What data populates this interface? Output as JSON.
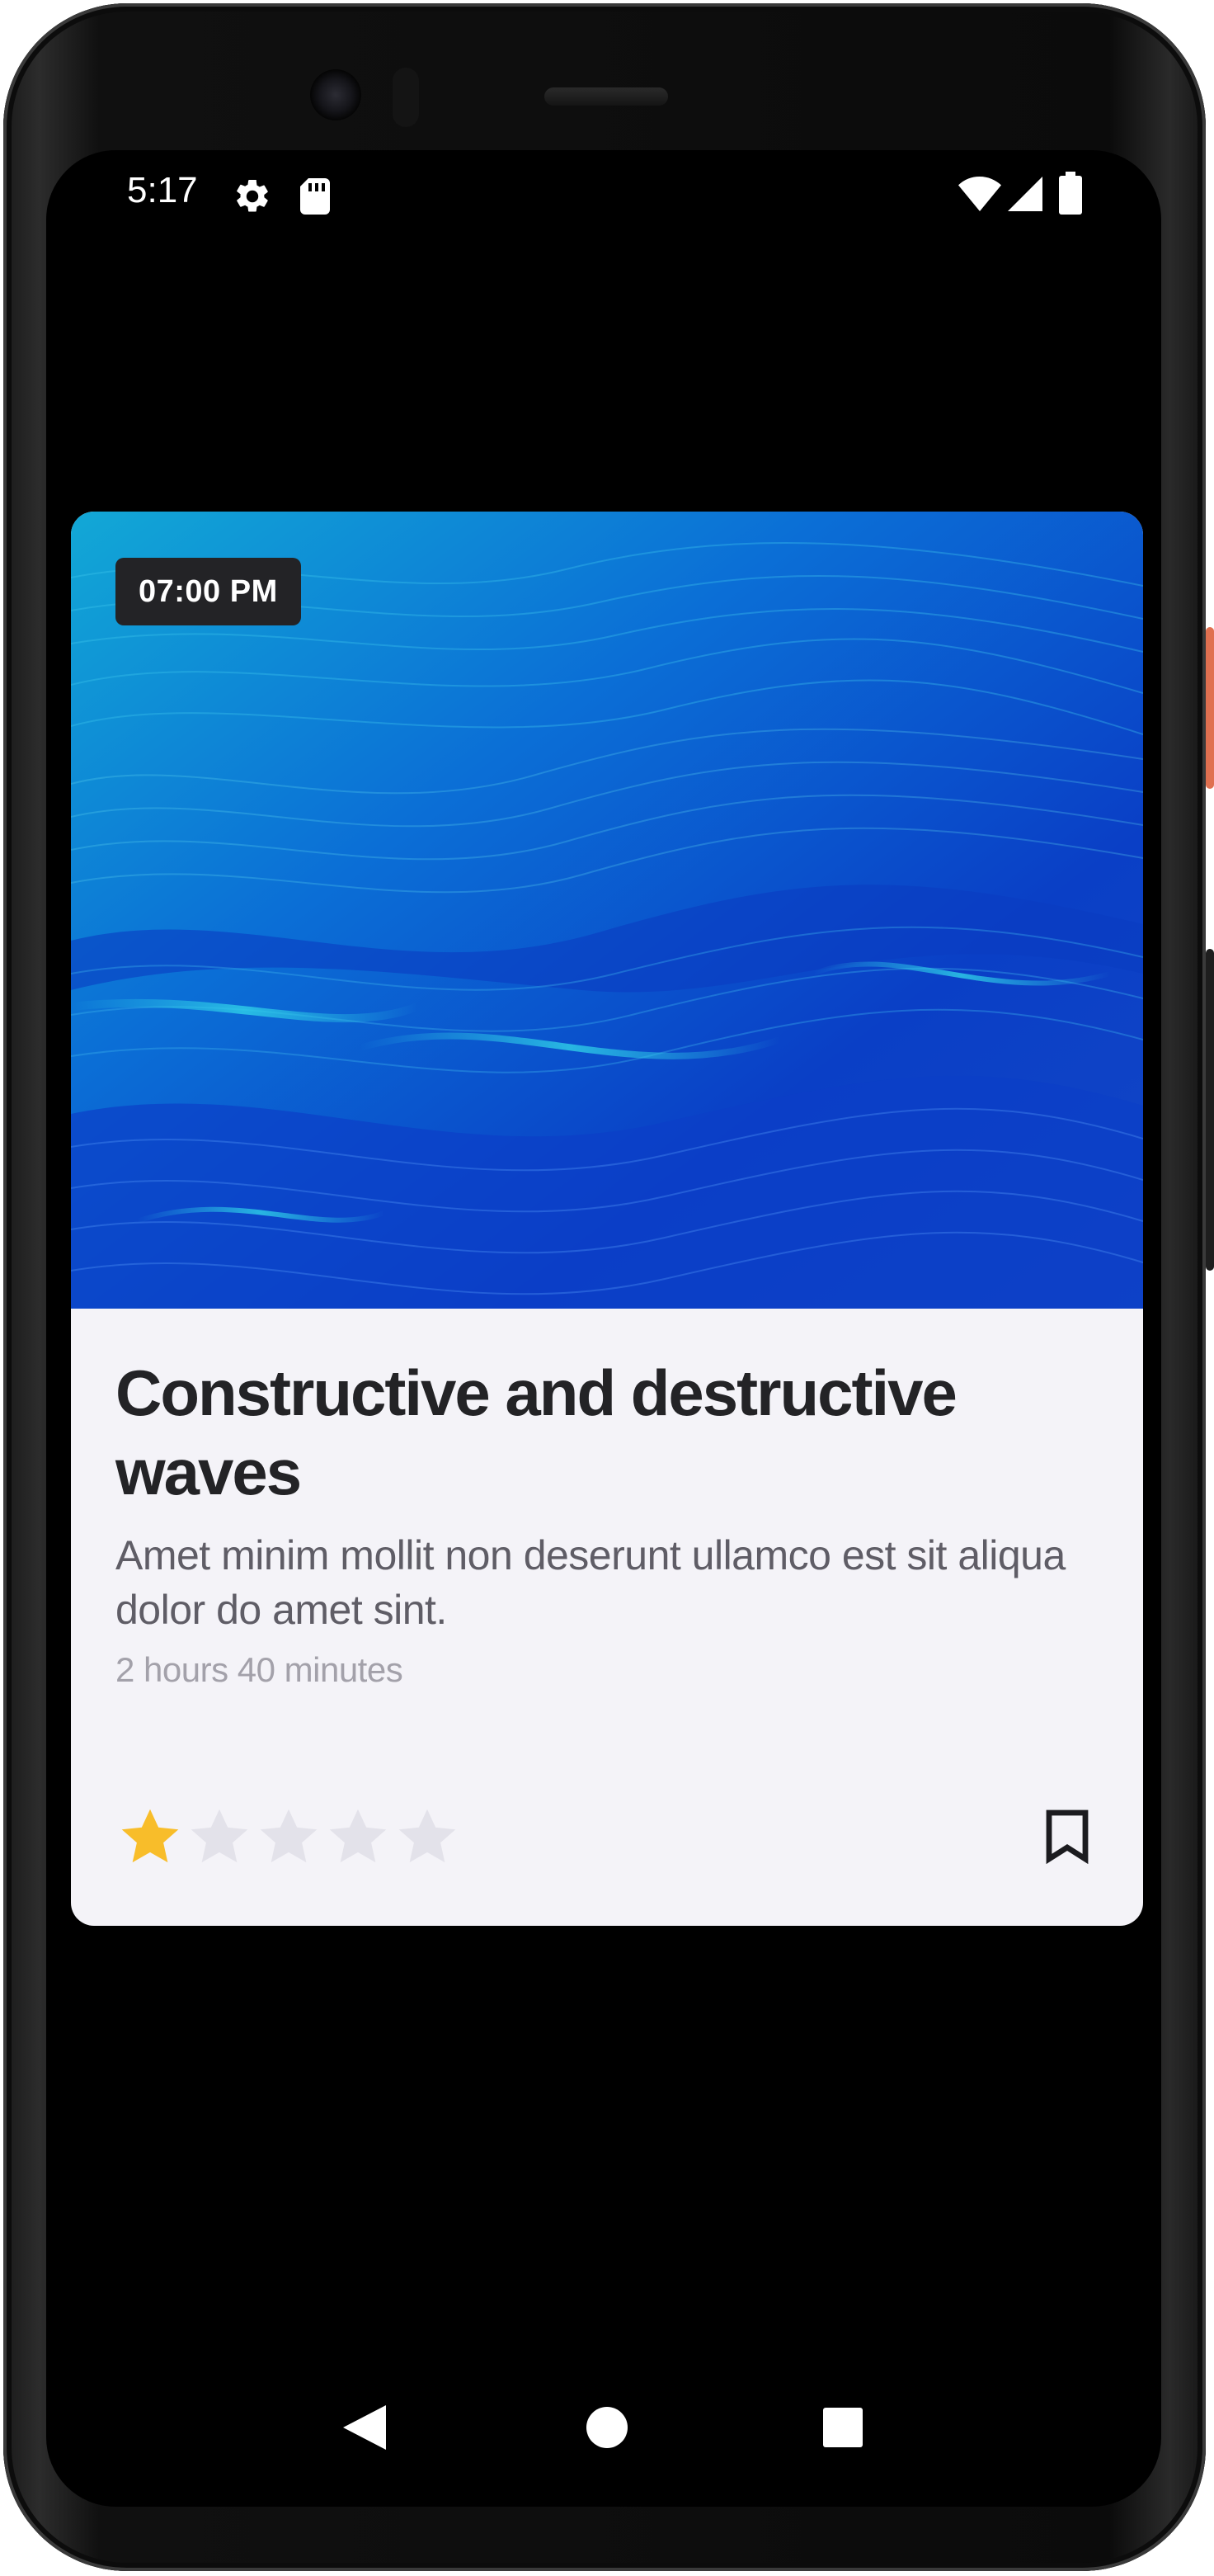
{
  "status_bar": {
    "time": "5:17",
    "icons": [
      "settings-icon",
      "sd-card-icon",
      "wifi-icon",
      "signal-icon",
      "battery-icon"
    ]
  },
  "card": {
    "image": "blue-waves-image",
    "time_badge": "07:00 PM",
    "title": "Constructive and destructive waves",
    "description": "Amet minim mollit non deserunt ullamco est sit aliqua dolor do amet sint.",
    "duration": "2 hours 40 minutes",
    "rating": {
      "value": 1,
      "max": 5
    },
    "bookmark": "bookmark-icon"
  },
  "nav_bar": {
    "buttons": [
      "back-icon",
      "home-icon",
      "recents-icon"
    ]
  },
  "colors": {
    "screen_background": "#000000",
    "card_background": "#f4f3f8",
    "title": "#232326",
    "description": "#5f5d66",
    "duration": "#a3a1aa",
    "star_filled": "#f8bd2a",
    "star_empty": "#e3e2ea",
    "badge_background": "#232326"
  }
}
